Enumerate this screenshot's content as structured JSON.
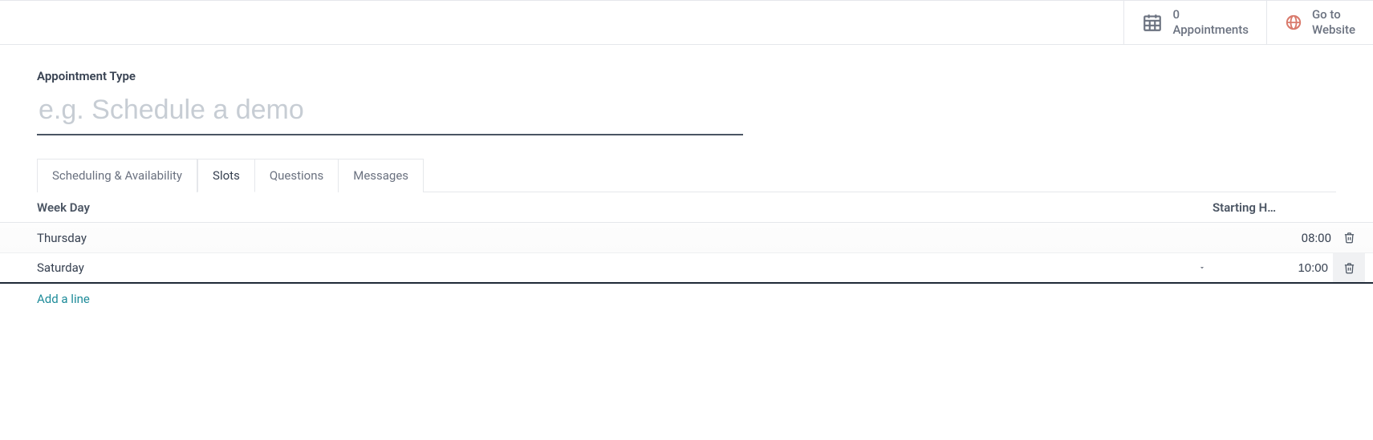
{
  "topbar": {
    "appointments": {
      "count": "0",
      "label": "Appointments"
    },
    "website": {
      "line1": "Go to",
      "line2": "Website"
    }
  },
  "form": {
    "type_label": "Appointment Type",
    "name_placeholder": "e.g. Schedule a demo",
    "name_value": ""
  },
  "tabs": {
    "scheduling": "Scheduling & Availability",
    "slots": "Slots",
    "questions": "Questions",
    "messages": "Messages"
  },
  "table": {
    "col_weekday": "Week Day",
    "col_hour": "Starting H…",
    "rows": [
      {
        "weekday": "Thursday",
        "hour": "08:00"
      },
      {
        "weekday": "Saturday",
        "hour": "10:00"
      }
    ],
    "add_line": "Add a line"
  }
}
